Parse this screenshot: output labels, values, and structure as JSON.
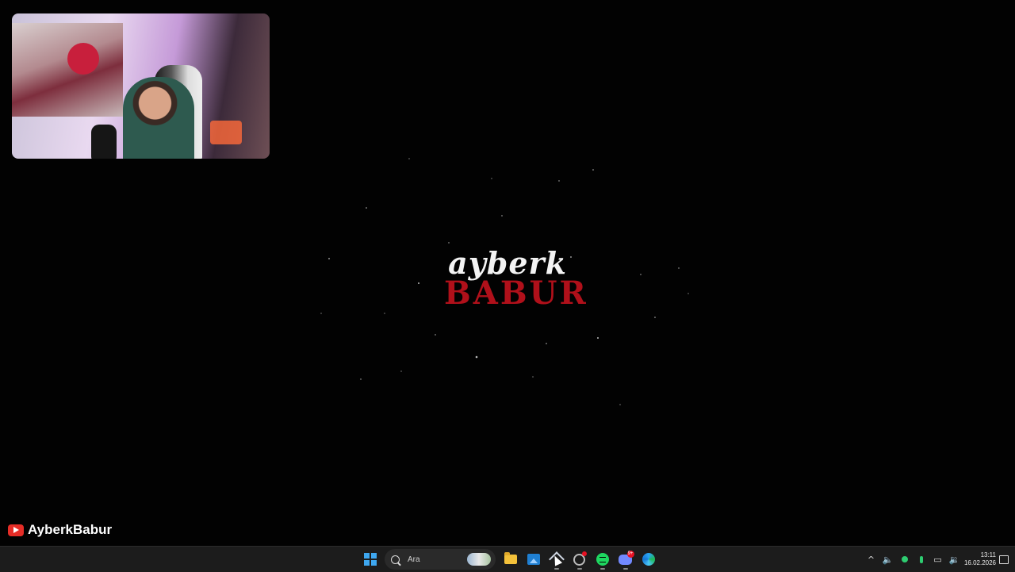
{
  "wallpaper": {
    "logo_line1": "ayberk",
    "logo_line2": "BABUR",
    "logo_line1_color": "#f3f3f3",
    "logo_line2_color": "#b0101a"
  },
  "webcam_overlay": {
    "visible": true
  },
  "channel_tag": {
    "platform_icon": "youtube-icon",
    "name": "AyberkBabur"
  },
  "taskbar": {
    "search_placeholder": "Ara",
    "apps": [
      {
        "name": "start",
        "icon": "windows-start-icon"
      },
      {
        "name": "file-explorer",
        "icon": "folder-icon"
      },
      {
        "name": "photos",
        "icon": "photos-icon"
      },
      {
        "name": "pinned-app",
        "icon": "pin-icon"
      },
      {
        "name": "app-with-badge",
        "icon": "circle-app-icon"
      },
      {
        "name": "spotify",
        "icon": "spotify-icon"
      },
      {
        "name": "discord",
        "icon": "discord-icon",
        "badge": "9+"
      },
      {
        "name": "edge",
        "icon": "edge-icon"
      }
    ],
    "tray": {
      "time": "13:11",
      "date": "16.02.2026"
    }
  }
}
